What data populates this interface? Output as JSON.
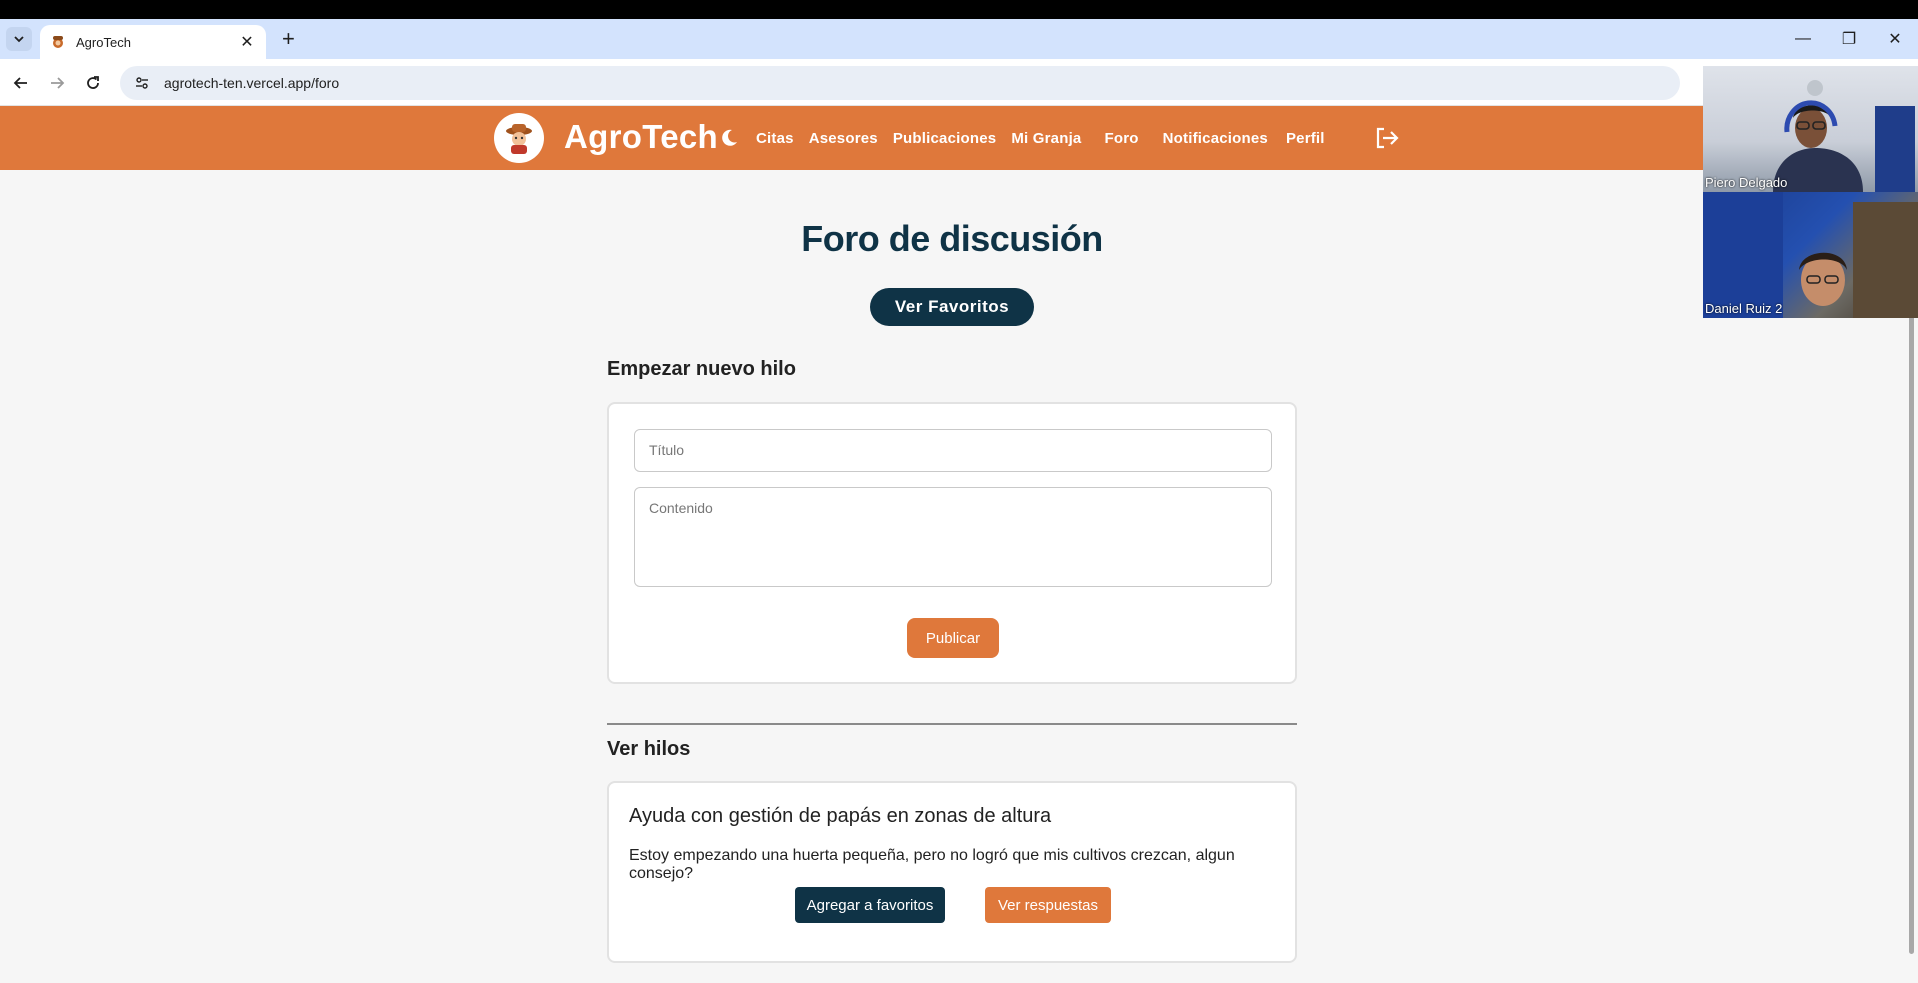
{
  "browser": {
    "tab_title": "AgroTech",
    "url": "agrotech-ten.vercel.app/foro"
  },
  "navbar": {
    "brand": "AgroTech",
    "links": [
      "Citas",
      "Asesores",
      "Publicaciones",
      "Mi Granja",
      "Foro",
      "Notificaciones",
      "Perfil"
    ],
    "accent_color": "#df783b",
    "dark_color": "#0f3346"
  },
  "page": {
    "title": "Foro de discusión",
    "favorites_button": "Ver Favoritos"
  },
  "new_thread": {
    "heading": "Empezar nuevo hilo",
    "title_placeholder": "Título",
    "content_placeholder": "Contenido",
    "submit_label": "Publicar"
  },
  "threads": {
    "heading": "Ver hilos",
    "items": [
      {
        "title": "Ayuda con gestión de papás en zonas de altura",
        "body": "Estoy empezando una huerta pequeña, pero no logró que mis cultivos crezcan, algun consejo?",
        "favorite_label": "Agregar a favoritos",
        "replies_label": "Ver respuestas"
      }
    ]
  },
  "video_call": {
    "participants": [
      "Piero Delgado",
      "Daniel Ruiz 2"
    ]
  }
}
